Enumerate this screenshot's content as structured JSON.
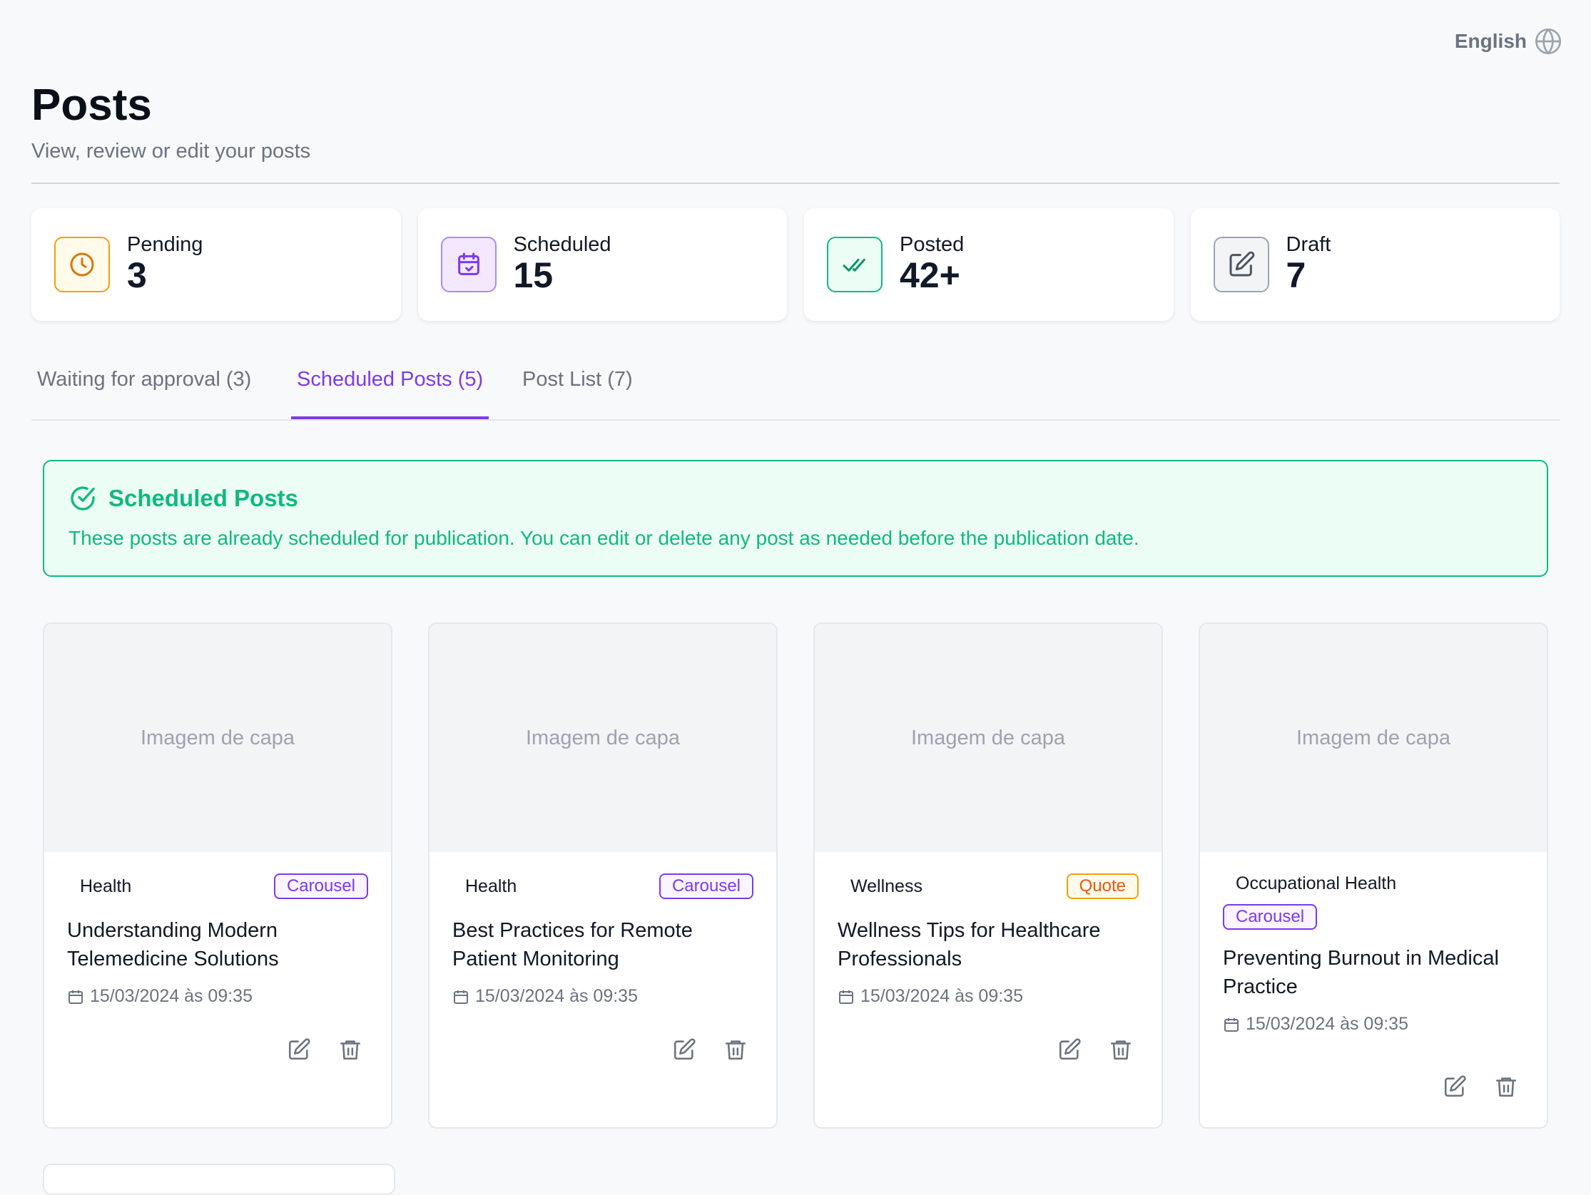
{
  "language": {
    "label": "English",
    "icon": "globe-icon"
  },
  "header": {
    "title": "Posts",
    "subtitle": "View, review or edit your posts"
  },
  "stats": [
    {
      "label": "Pending",
      "value": "3",
      "icon": "clock-icon",
      "color": "#f59e0b"
    },
    {
      "label": "Scheduled",
      "value": "15",
      "icon": "calendar-check-icon",
      "color": "#7c3aed"
    },
    {
      "label": "Posted",
      "value": "42+",
      "icon": "double-check-icon",
      "color": "#10b981"
    },
    {
      "label": "Draft",
      "value": "7",
      "icon": "edit-icon",
      "color": "#4b5563"
    }
  ],
  "tabs": [
    {
      "label": "Waiting for approval (3)",
      "active": false
    },
    {
      "label": "Scheduled Posts (5)",
      "active": true
    },
    {
      "label": "Post List (7)",
      "active": false
    }
  ],
  "banner": {
    "title": "Scheduled Posts",
    "text": "These posts are already scheduled for publication. You can edit or delete any post as needed before the publication date.",
    "color": "#10b981"
  },
  "posts": [
    {
      "cover": "Imagem de capa",
      "category": "Health",
      "type": "Carousel",
      "title": "Understanding Modern Telemedicine Solutions",
      "date": "15/03/2024 às 09:35"
    },
    {
      "cover": "Imagem de capa",
      "category": "Health",
      "type": "Carousel",
      "title": "Best Practices for Remote Patient Monitoring",
      "date": "15/03/2024 às 09:35"
    },
    {
      "cover": "Imagem de capa",
      "category": "Wellness",
      "type": "Quote",
      "title": "Wellness Tips for Healthcare Professionals",
      "date": "15/03/2024 às 09:35"
    },
    {
      "cover": "Imagem de capa",
      "category": "Occupational Health",
      "type": "Carousel",
      "title": "Preventing Burnout in Medical Practice",
      "date": "15/03/2024 às 09:35"
    }
  ],
  "colors": {
    "accent": "#7c3aed",
    "success": "#10b981",
    "warning": "#f59e0b"
  }
}
